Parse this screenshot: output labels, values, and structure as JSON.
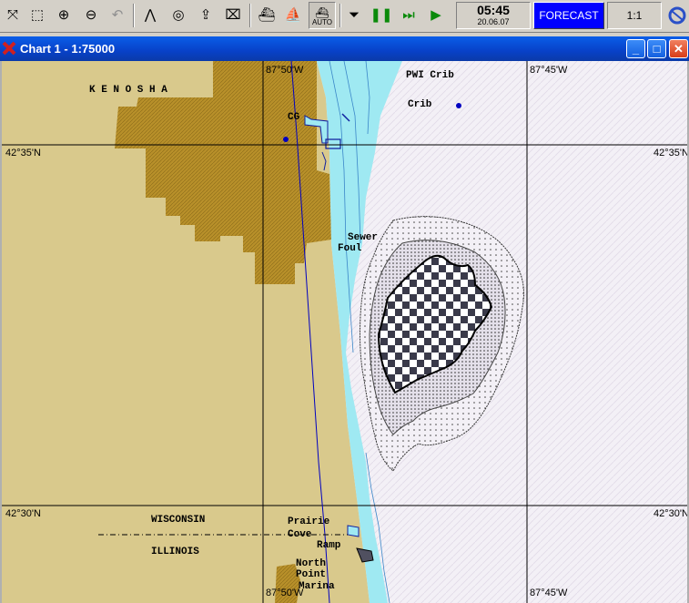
{
  "toolbar": {
    "tools": [
      "cursor-cross-icon",
      "zoom-window-icon",
      "zoom-in-icon",
      "zoom-out-icon",
      "undo-icon",
      "route-icon",
      "target-icon",
      "export-icon",
      "erase-icon",
      "ship-icon",
      "ship-small-icon",
      "auto-ship-icon",
      "down-icon",
      "pause-icon",
      "fast-forward-icon",
      "play-icon"
    ],
    "auto_label": "AUTO",
    "time": "05:45",
    "date": "20.06.07",
    "forecast_label": "FORECAST",
    "scale_label": "1:1"
  },
  "window": {
    "title": "Chart 1 - 1:75000",
    "minimize": "_",
    "maximize": "□",
    "close": "✕"
  },
  "chart": {
    "coords": {
      "lon_left": "87°50'W",
      "lon_right": "87°45'W",
      "lat_top": "42°35'N",
      "lat_bottom": "42°30'N"
    },
    "labels": {
      "kenosha": "K E N O S H A",
      "cg": "CG",
      "pwi_crib": "PWI Crib",
      "crib": "Crib",
      "sewer": "Sewer",
      "foul": "Foul",
      "wisconsin": "WISCONSIN",
      "illinois": "ILLINOIS",
      "prairie": "Prairie",
      "cove": "Cove",
      "ramp": "Ramp",
      "north": "North",
      "point": "Point",
      "marina": "Marina"
    },
    "colors": {
      "land": "#d9c98c",
      "urban": "#b8902a",
      "shallow": "#9fe9f2",
      "water": "#f3f0f6",
      "grid": "#000000",
      "route": "#0000c0"
    }
  }
}
